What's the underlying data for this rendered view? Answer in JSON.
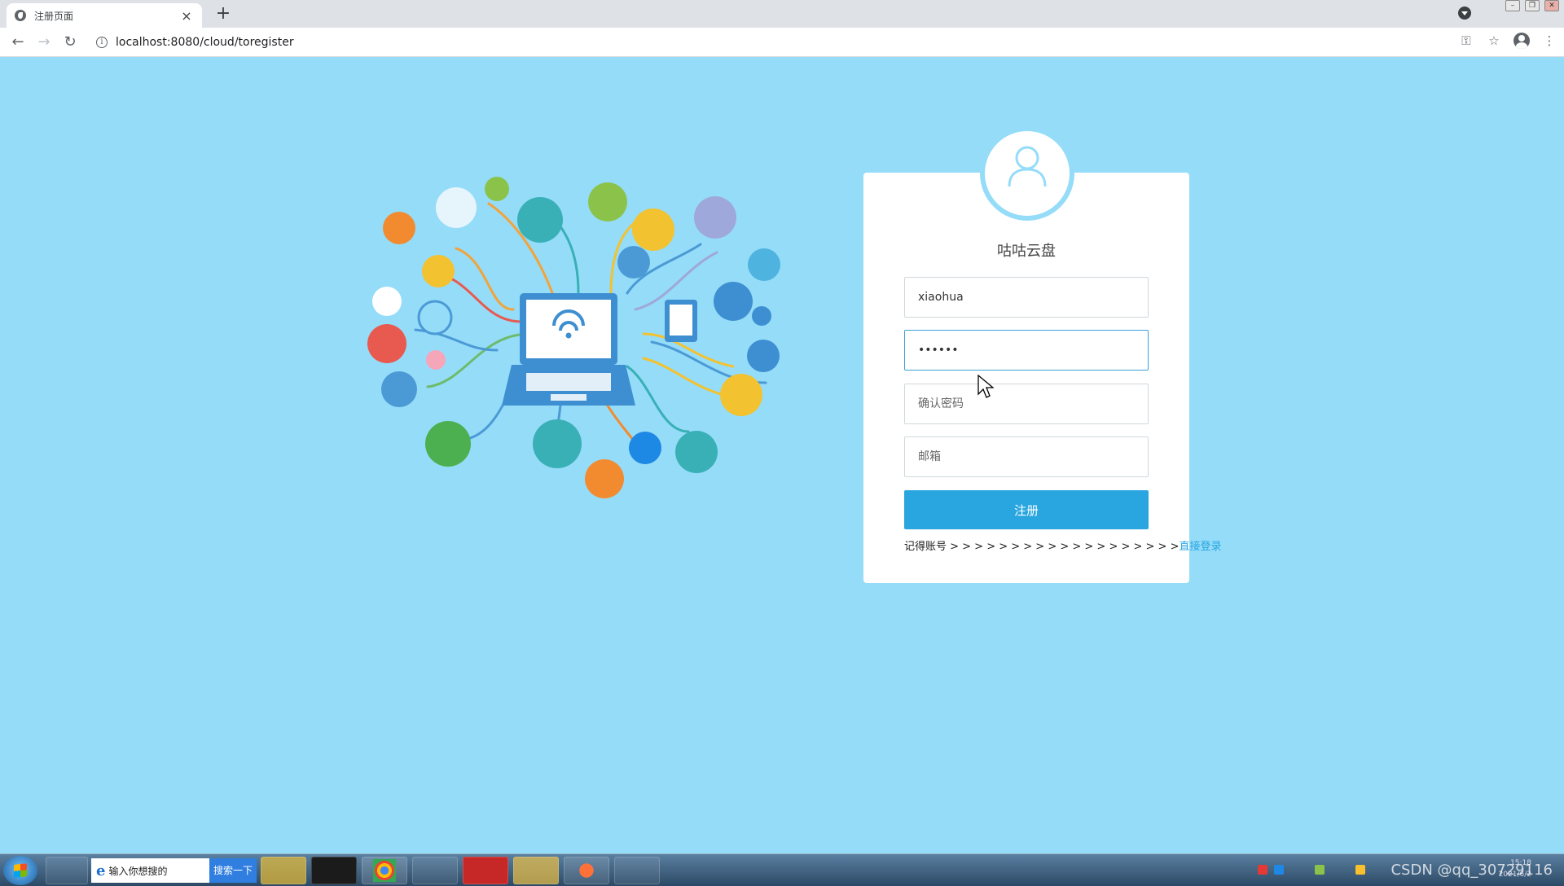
{
  "browser": {
    "tab_title": "注册页面",
    "tab_close": "×",
    "new_tab": "+",
    "url": "localhost:8080/cloud/toregister"
  },
  "card": {
    "title": "咕咕云盘",
    "username_value": "xiaohua",
    "password_value": "••••••",
    "confirm_placeholder": "确认密码",
    "email_placeholder": "邮箱",
    "register_label": "注册",
    "login_prompt": "记得账号 > > > > > > > > > > > > > > > > > > >",
    "login_link": "直接登录"
  },
  "taskbar": {
    "search_placeholder": "输入你想搜的",
    "search_button": "搜索一下",
    "watermark": "CSDN @qq_30729116",
    "clock_time": "15:18",
    "clock_date": "2021/6/2"
  },
  "colors": {
    "page_background": "#95dcf9",
    "accent": "#29a6e0"
  },
  "icons": [
    "favicon-icon",
    "back-icon",
    "forward-icon",
    "reload-icon",
    "info-icon",
    "key-icon",
    "star-icon",
    "profile-icon",
    "user-avatar-icon",
    "cursor-icon",
    "start-icon"
  ]
}
